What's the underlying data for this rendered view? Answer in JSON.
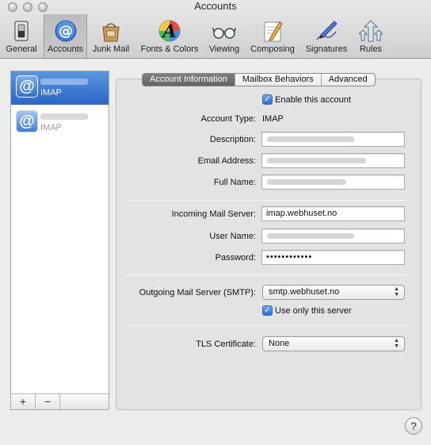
{
  "window": {
    "title": "Accounts"
  },
  "toolbar": {
    "items": [
      {
        "label": "General",
        "icon": "switch-icon"
      },
      {
        "label": "Accounts",
        "icon": "at-icon"
      },
      {
        "label": "Junk Mail",
        "icon": "junk-bag-icon"
      },
      {
        "label": "Fonts & Colors",
        "icon": "font-icon"
      },
      {
        "label": "Viewing",
        "icon": "glasses-icon"
      },
      {
        "label": "Composing",
        "icon": "pencil-icon"
      },
      {
        "label": "Signatures",
        "icon": "pen-icon"
      },
      {
        "label": "Rules",
        "icon": "rules-icon"
      }
    ],
    "active": "Accounts"
  },
  "sidebar": {
    "accounts": [
      {
        "type": "IMAP",
        "selected": true
      },
      {
        "type": "IMAP",
        "selected": false
      }
    ],
    "add_label": "+",
    "remove_label": "−"
  },
  "tabs": {
    "items": [
      "Account Information",
      "Mailbox Behaviors",
      "Advanced"
    ],
    "active": "Account Information"
  },
  "form": {
    "enable_label": "Enable this account",
    "account_type_label": "Account Type:",
    "account_type_value": "IMAP",
    "description_label": "Description:",
    "email_label": "Email Address:",
    "full_name_label": "Full Name:",
    "incoming_label": "Incoming Mail Server:",
    "incoming_value": "imap.webhuset.no",
    "user_name_label": "User Name:",
    "password_label": "Password:",
    "password_value": "••••••••••••",
    "smtp_label": "Outgoing Mail Server (SMTP):",
    "smtp_value": "smtp.webhuset.no",
    "use_only_label": "Use only this server",
    "tls_label": "TLS Certificate:",
    "tls_value": "None"
  },
  "help_label": "?",
  "colors": {
    "selection": "#2a65c7",
    "accent": "#3b7ad9"
  }
}
